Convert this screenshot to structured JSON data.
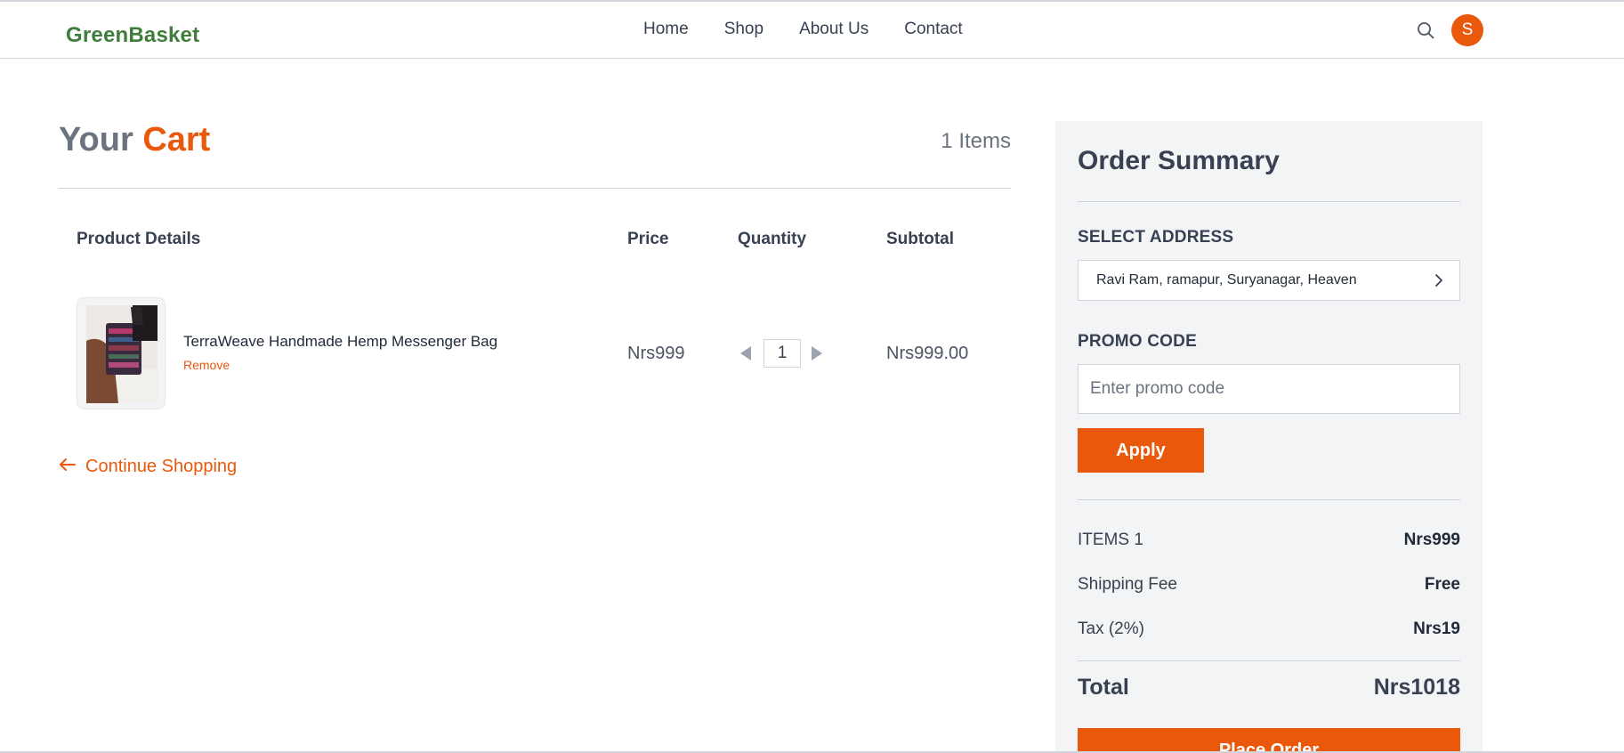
{
  "brand": {
    "name": "GreenBasket",
    "color": "#3f7d3a",
    "accent": "#ea580c"
  },
  "nav": {
    "links": [
      "Home",
      "Shop",
      "About Us",
      "Contact"
    ]
  },
  "user": {
    "initial": "S"
  },
  "cart": {
    "title_prefix": "Your",
    "title_accent": "Cart",
    "items_count": "1 Items",
    "headers": {
      "product": "Product Details",
      "price": "Price",
      "quantity": "Quantity",
      "subtotal": "Subtotal"
    },
    "items": [
      {
        "name": "TerraWeave Handmade Hemp Messenger Bag",
        "remove_label": "Remove",
        "price": "Nrs999",
        "quantity": "1",
        "subtotal": "Nrs999.00"
      }
    ],
    "continue_label": "Continue Shopping"
  },
  "summary": {
    "title": "Order Summary",
    "address_label": "SELECT ADDRESS",
    "address_value": "Ravi Ram, ramapur, Suryanagar, Heaven",
    "promo_label": "PROMO CODE",
    "promo_placeholder": "Enter promo code",
    "apply_label": "Apply",
    "rows": [
      {
        "label": "ITEMS 1",
        "value": "Nrs999"
      },
      {
        "label": "Shipping Fee",
        "value": "Free"
      },
      {
        "label": "Tax (2%)",
        "value": "Nrs19"
      }
    ],
    "total_label": "Total",
    "total_value": "Nrs1018",
    "place_order_label": "Place Order"
  },
  "icons": [
    "search-icon",
    "chevron-right-icon",
    "arrow-left-icon",
    "triangle-left-icon",
    "triangle-right-icon"
  ]
}
